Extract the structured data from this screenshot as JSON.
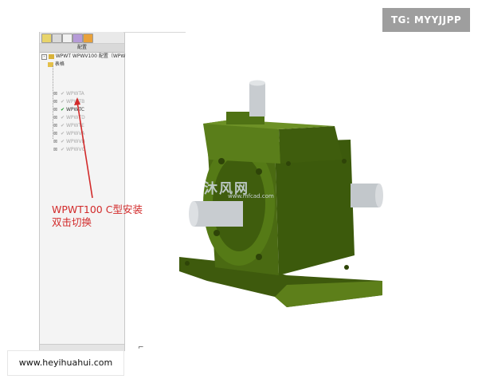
{
  "panel": {
    "tab_label": "配置",
    "root_label": "WPWT   WPWV100 配置（WPW",
    "folder_label": "表格",
    "configs": [
      {
        "label": "WPWTA",
        "active": false
      },
      {
        "label": "WPWTB",
        "active": false
      },
      {
        "label": "WPWTC",
        "active": true
      },
      {
        "label": "WPWTD",
        "active": false
      },
      {
        "label": "WPWTE",
        "active": false
      },
      {
        "label": "WPWVA",
        "active": false
      },
      {
        "label": "WPWVB",
        "active": false
      },
      {
        "label": "WPWVC",
        "active": false
      }
    ]
  },
  "annotation": {
    "line1": "WPWT100 C型安装",
    "line2": "双击切换"
  },
  "watermark": {
    "main": "沐风网",
    "sub": "www.mfcad.com"
  },
  "tag_top": "TG: MYYJJPP",
  "tag_bottom": "www.heyihuahui.com",
  "colors": {
    "gearbox_green": "#4a6a12",
    "gearbox_dark": "#2f4709",
    "shaft_grey": "#c8ccd0",
    "annotation_red": "#d22a2a"
  },
  "icons": [
    "feature-tree-icon",
    "property-icon",
    "config-icon",
    "display-icon",
    "appearance-icon"
  ]
}
